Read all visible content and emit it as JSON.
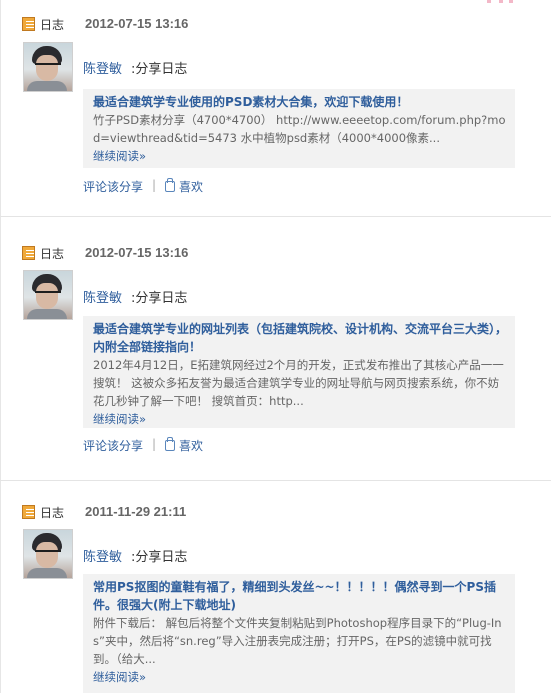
{
  "entries": [
    {
      "type_label": "日志",
      "date": "2012-07-15 13:16",
      "author": "陈登敏",
      "action": ":分享日志",
      "title": "最适合建筑学专业使用的PSD素材大合集，欢迎下载使用！",
      "body": "竹子PSD素材分享（4700*4700） http://www.eeeetop.com/forum.php?mod=viewthread&tid=5473 水中植物psd素材（4000*4000像素...",
      "more": "继续阅读»",
      "comment": "评论该分享",
      "divider": "|",
      "like": "喜欢"
    },
    {
      "type_label": "日志",
      "date": "2012-07-15 13:16",
      "author": "陈登敏",
      "action": ":分享日志",
      "title": "最适合建筑学专业的网址列表（包括建筑院校、设计机构、交流平台三大类），内附全部链接指向！",
      "body": "2012年4月12日，E拓建筑网经过2个月的开发，正式发布推出了其核心产品一一搜筑！ 这被众多拓友誉为最适合建筑学专业的网址导航与网页搜索系统，你不妨花几秒钟了解一下吧！ 搜筑首页：http...",
      "more": "继续阅读»",
      "comment": "评论该分享",
      "divider": "|",
      "like": "喜欢"
    },
    {
      "type_label": "日志",
      "date": "2011-11-29 21:11",
      "author": "陈登敏",
      "action": ":分享日志",
      "title": "常用PS抠图的童鞋有福了，精细到头发丝~~！！！！！偶然寻到一个PS插件。很强大(附上下载地址)",
      "body": "附件下载后： 解包后将整个文件夹复制粘贴到Photoshop程序目录下的“Plug-Ins”夹中，然后将“sn.reg”导入注册表完成注册；打开PS，在PS的滤镜中就可找到。（给大...",
      "more": "继续阅读»",
      "comment": null,
      "divider": null,
      "like": null
    }
  ]
}
